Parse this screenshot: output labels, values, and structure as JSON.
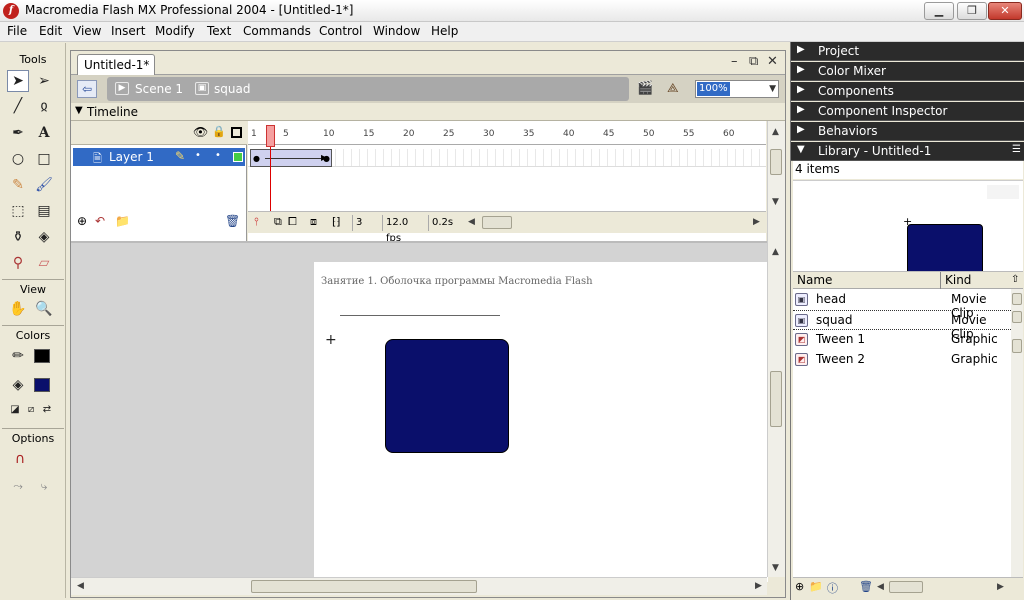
{
  "window": {
    "title": "Macromedia Flash MX Professional 2004 - [Untitled-1*]",
    "minimize": "▁",
    "restore": "❐",
    "close": "✕"
  },
  "menu": [
    "File",
    "Edit",
    "View",
    "Insert",
    "Modify",
    "Text",
    "Commands",
    "Control",
    "Window",
    "Help"
  ],
  "tools": {
    "header": "Tools",
    "view_label": "View",
    "colors_label": "Colors",
    "options_label": "Options",
    "stroke_color": "#000000",
    "fill_color": "#0a0f6b"
  },
  "document": {
    "tab_label": "Untitled-1*",
    "scene": "Scene 1",
    "symbol": "squad",
    "zoom": "100%",
    "controls": {
      "minimize": "–",
      "restore": "⧉",
      "close": "✕"
    }
  },
  "timeline": {
    "label": "Timeline",
    "layer_name": "Layer 1",
    "ruler_ticks": [
      "1",
      "5",
      "10",
      "15",
      "20",
      "25",
      "30",
      "35",
      "40",
      "45",
      "50",
      "55",
      "60"
    ],
    "current_frame": "3",
    "frame_rate": "12.0 fps",
    "elapsed_time": "0.2s"
  },
  "stage": {
    "heading": "Занятие 1. Оболочка программы Macromedia Flash",
    "shape_color": "#0a0f6b"
  },
  "panels": [
    "Project",
    "Color Mixer",
    "Components",
    "Component Inspector",
    "Behaviors"
  ],
  "library": {
    "title": "Library - Untitled-1",
    "count": "4 items",
    "columns": {
      "name": "Name",
      "kind": "Kind"
    },
    "items": [
      {
        "name": "head",
        "kind": "Movie Clip",
        "icon": "movie-clip-icon"
      },
      {
        "name": "squad",
        "kind": "Movie Clip",
        "icon": "movie-clip-icon"
      },
      {
        "name": "Tween 1",
        "kind": "Graphic",
        "icon": "graphic-icon"
      },
      {
        "name": "Tween 2",
        "kind": "Graphic",
        "icon": "graphic-icon"
      }
    ]
  }
}
